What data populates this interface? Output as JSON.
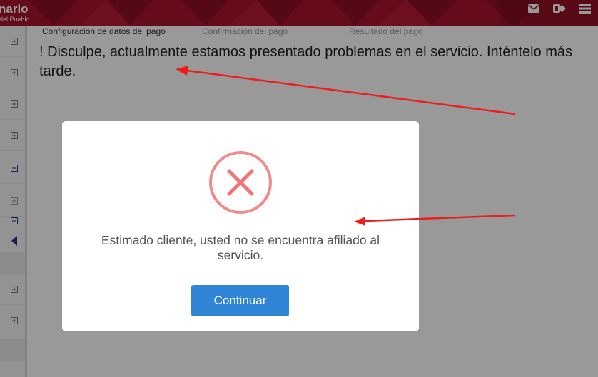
{
  "header": {
    "brand_main": "nario",
    "brand_sub": "del Pueblo",
    "icons": [
      "envelope-icon",
      "logout-icon",
      "menu-icon"
    ],
    "color": "#b0142c"
  },
  "steps": [
    {
      "label": "Configuración de datos del pago",
      "active": true
    },
    {
      "label": "Confirmación del pago",
      "active": false
    },
    {
      "label": "Resultado del pago",
      "active": false
    }
  ],
  "main": {
    "error_message": "! Disculpe, actualmente estamos presentado problemas en el servicio. Inténtelo más tarde."
  },
  "modal": {
    "icon": "error-x-icon",
    "icon_color": "#f27474",
    "message": "Estimado cliente, usted no se encuentra afiliado al servicio.",
    "button_label": "Continuar",
    "button_color": "#3085d6"
  },
  "annotation_color": "#ee1c1c"
}
